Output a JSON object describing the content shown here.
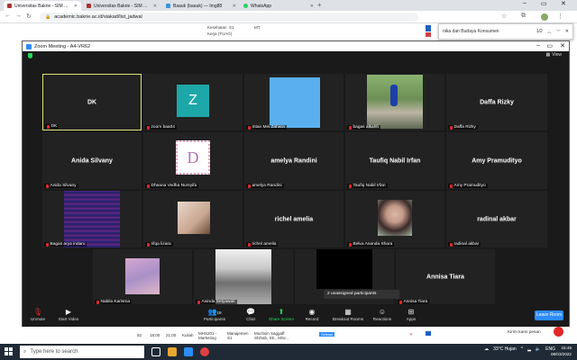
{
  "browser": {
    "tabs": [
      {
        "title": "Universitas Bakrie - SIM Akade",
        "color": "#b03030",
        "active": true
      },
      {
        "title": "Universitas Bakrie - SIM Akade",
        "color": "#b03030",
        "active": false
      },
      {
        "title": "Baauk (baauk) — Img88",
        "color": "#3b95d8",
        "active": false
      },
      {
        "title": "WhatsApp",
        "color": "#25d366",
        "active": false
      }
    ],
    "new_tab": "+",
    "url": "academic.bakrie.ac.id/siakad/list_jadwal",
    "find": {
      "query": "nika dan Budaya Konsumen",
      "count": "1/2"
    }
  },
  "webpage": {
    "row1": {
      "a": "Kesehatan",
      "b": "Kerja (TUAG)",
      "c": "S1",
      "d": "MT."
    },
    "row2": {
      "no": "82",
      "start": "18:00",
      "end": "21:00",
      "type": "Kuliah",
      "code": "MHS201 - Marketing",
      "prodi": "Manajemen S1",
      "lecturer": "Muchsin Saggaff Shihab, SE., MSc.,",
      "badge": "Selesai"
    }
  },
  "zoom": {
    "title": "Zoom Meeting - A4-VR62",
    "view_label": "View",
    "participants": [
      {
        "tile_text": "DK",
        "label": "DK"
      },
      {
        "tile_text": "Z",
        "label": "zoom baa04"
      },
      {
        "tile_text": "",
        "label": "Intan Mei Zahara"
      },
      {
        "tile_text": "",
        "label": "bagas alkahfi"
      },
      {
        "tile_text": "Daffa Rizky",
        "label": "Daffa Rizky"
      },
      {
        "tile_text": "Anida Silvany",
        "label": "Anida Silvany"
      },
      {
        "tile_text": "D",
        "label": "Dheana Vedha Nursyifa"
      },
      {
        "tile_text": "amelya Randini",
        "label": "amelya Randini"
      },
      {
        "tile_text": "Taufiq Nabil Irfan",
        "label": "Taufiq Nabil Irfan"
      },
      {
        "tile_text": "Amy Pramudityo",
        "label": "Amy Pramudityo"
      },
      {
        "tile_text": "",
        "label": "Bagas arya indaru"
      },
      {
        "tile_text": "",
        "label": "rifqa lizara"
      },
      {
        "tile_text": "richel amelia",
        "label": "richel amelia"
      },
      {
        "tile_text": "",
        "label": "Belva Ananda Shara"
      },
      {
        "tile_text": "radinal akbar",
        "label": "radinal akbar"
      },
      {
        "tile_text": "",
        "label": "Nabila Karisma"
      },
      {
        "tile_text": "",
        "label": "Aninda Setyawati"
      },
      {
        "tile_text": "",
        "label": ""
      },
      {
        "tile_text": "Annisa Tiara",
        "label": "Annisa Tiara"
      }
    ],
    "unassigned": "2 unassigned participants",
    "toolbar": {
      "unmute": "Unmute",
      "start_video": "Start Video",
      "participants": "Participants",
      "participants_count": "19",
      "chat": "Chat",
      "share_screen": "Share Screen",
      "record": "Record",
      "breakout": "Breakout Rooms",
      "reactions": "Reactions",
      "apps": "Apps",
      "leave": "Leave Room"
    }
  },
  "kirim_pesan": "Kirim kami pesan",
  "taskbar": {
    "search_placeholder": "Type here to search",
    "weather": "33°C Hujan",
    "lang": "ENG",
    "time": "15:46",
    "date": "08/03/2022"
  },
  "colors": {
    "zoom_blue": "#2d8cff",
    "share_green": "#23d959",
    "taskbar": "#1f2a36"
  }
}
